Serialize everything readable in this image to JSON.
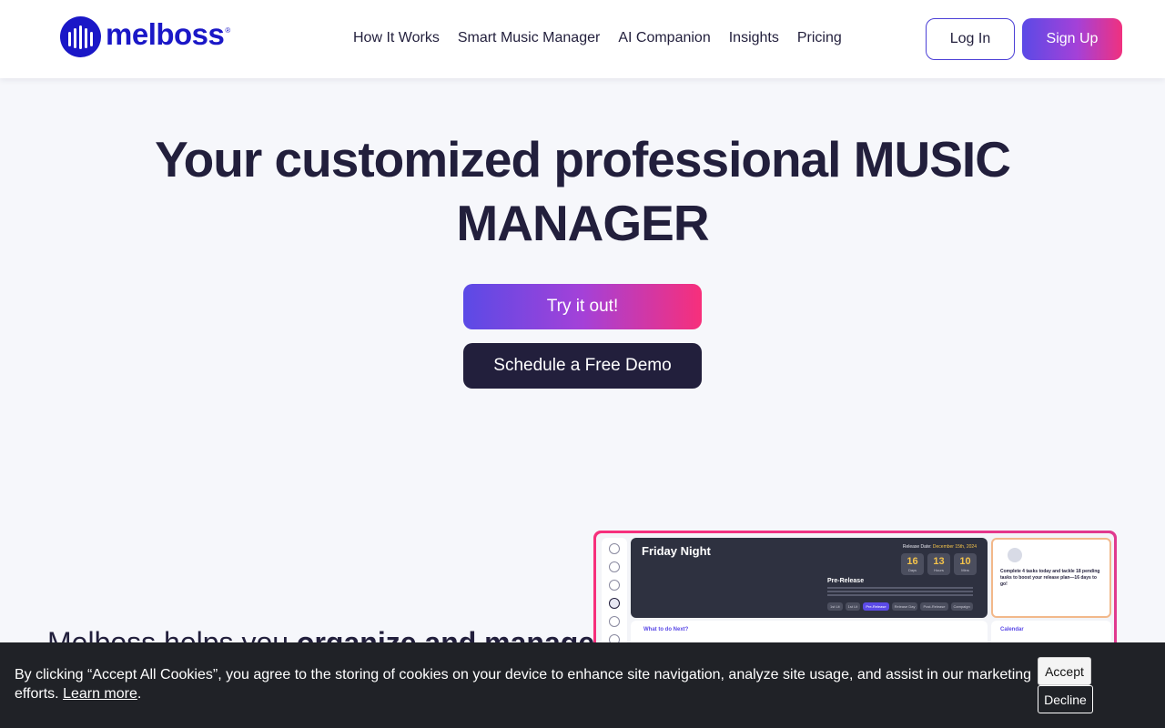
{
  "brand": {
    "name": "melboss",
    "registered_mark": "®",
    "color": "#1a17c7"
  },
  "nav": {
    "items": [
      {
        "label": "How It Works"
      },
      {
        "label": "Smart Music Manager"
      },
      {
        "label": "AI Companion"
      },
      {
        "label": "Insights"
      },
      {
        "label": "Pricing"
      }
    ],
    "login_label": "Log In",
    "signup_label": "Sign Up"
  },
  "hero": {
    "title": "Your customized professional MUSIC MANAGER",
    "try_label": "Try it out!",
    "demo_label": "Schedule a Free Demo"
  },
  "intro": {
    "lead": "Melboss helps you ",
    "emphasis": "organize and manage"
  },
  "preview": {
    "project_title": "Friday Night",
    "release_label": "Release Date:",
    "release_date": "December 15th, 2024",
    "counters": [
      {
        "value": "16",
        "unit": "Days"
      },
      {
        "value": "13",
        "unit": "Hours"
      },
      {
        "value": "10",
        "unit": "Mins"
      }
    ],
    "stage_title": "Pre-Release",
    "stages": [
      "1st Lit",
      "1st Lit",
      "Pre-Release",
      "Release Day",
      "Post-Release",
      "Campaign"
    ],
    "ai_message": "Complete 4 tasks today and tackle 18 pending tasks to boost your release plan—16 days to go!",
    "next_title": "What to do Next?",
    "calendar_title": "Calendar"
  },
  "cookie": {
    "text": "By clicking “Accept All Cookies”, you agree to the storing of cookies on your device to enhance site navigation, analyze site usage, and assist in our marketing efforts. ",
    "link_label": "Learn more",
    "suffix": ".",
    "accept_label": "Accept",
    "decline_label": "Decline"
  },
  "colors": {
    "accent_start": "#5b4ae6",
    "accent_end": "#f72f7b",
    "dark": "#221f3c",
    "background": "#f6f7fb",
    "cookie_bg": "#202227"
  }
}
